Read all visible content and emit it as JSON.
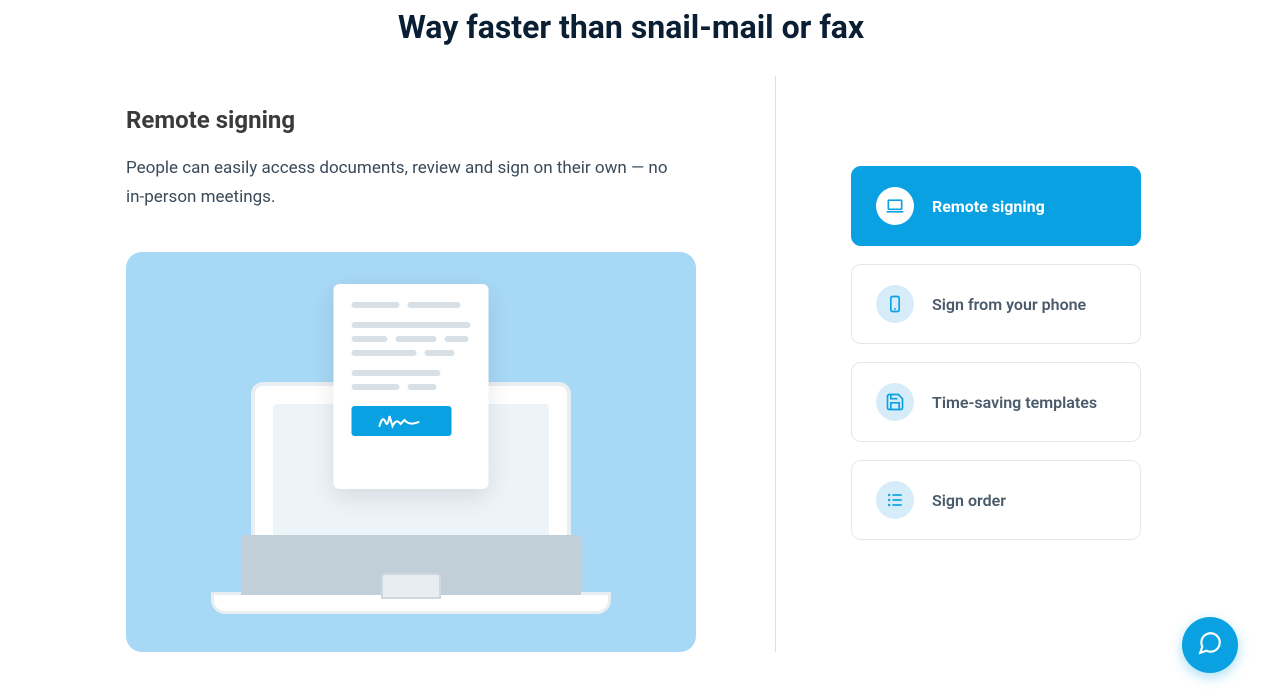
{
  "header": {
    "title": "Way faster than snail-mail or fax"
  },
  "feature": {
    "title": "Remote signing",
    "description": "People can easily access documents, review and sign on their own — no in-person meetings."
  },
  "options": [
    {
      "label": "Remote signing",
      "icon": "laptop",
      "active": true
    },
    {
      "label": "Sign from your phone",
      "icon": "phone",
      "active": false
    },
    {
      "label": "Time-saving templates",
      "icon": "save",
      "active": false
    },
    {
      "label": "Sign order",
      "icon": "list",
      "active": false
    }
  ],
  "colors": {
    "accent": "#0aa1e2",
    "illustration_bg": "#a7d8f5"
  }
}
